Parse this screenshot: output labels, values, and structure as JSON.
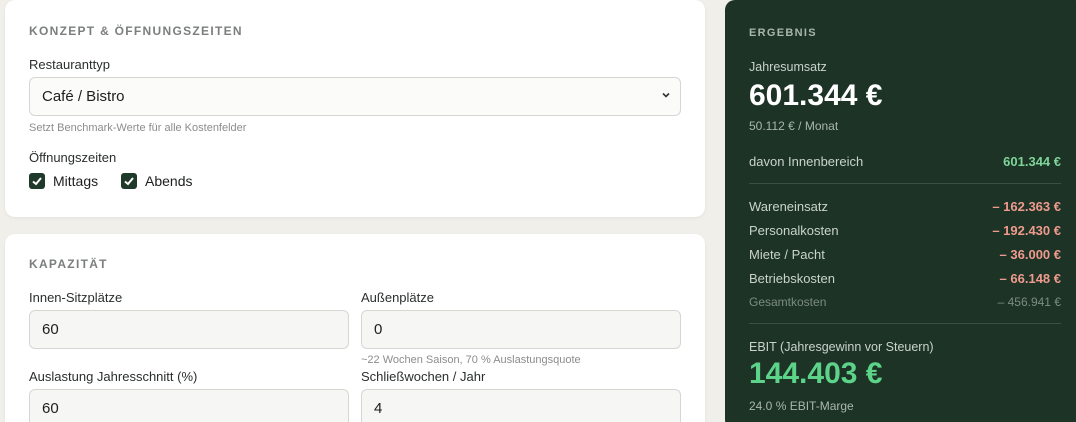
{
  "konzept": {
    "title": "KONZEPT & ÖFFNUNGSZEITEN",
    "restaurant_type_label": "Restauranttyp",
    "restaurant_type_value": "Café / Bistro",
    "restaurant_type_hint": "Setzt Benchmark-Werte für alle Kostenfelder",
    "opening_label": "Öffnungszeiten",
    "options": [
      {
        "label": "Mittags",
        "checked": true
      },
      {
        "label": "Abends",
        "checked": true
      }
    ]
  },
  "kapazitaet": {
    "title": "KAPAZITÄT",
    "indoor_label": "Innen-Sitzplätze",
    "indoor_value": "60",
    "outdoor_label": "Außenplätze",
    "outdoor_value": "0",
    "outdoor_hint": "~22 Wochen Saison, 70 % Auslastungsquote",
    "occupancy_label": "Auslastung Jahresschnitt (%)",
    "occupancy_value": "60",
    "closing_label": "Schließwochen / Jahr",
    "closing_value": "4"
  },
  "result": {
    "title": "ERGEBNIS",
    "revenue_label": "Jahresumsatz",
    "revenue_value": "601.344 €",
    "revenue_monthly": "50.112 € / Monat",
    "indoor_share_label": "davon Innenbereich",
    "indoor_share_value": "601.344 €",
    "costs": [
      {
        "label": "Wareneinsatz",
        "value": "– 162.363 €"
      },
      {
        "label": "Personalkosten",
        "value": "– 192.430 €"
      },
      {
        "label": "Miete / Pacht",
        "value": "– 36.000 €"
      },
      {
        "label": "Betriebskosten",
        "value": "– 66.148 €"
      }
    ],
    "total_label": "Gesamtkosten",
    "total_value": "– 456.941 €",
    "ebit_label": "EBIT (Jahresgewinn vor Steuern)",
    "ebit_value": "144.403 €",
    "ebit_margin": "24.0 % EBIT-Marge"
  },
  "colors": {
    "panel_bg": "#1c3325",
    "positive": "#5cd389",
    "negative": "#f09a8e",
    "checkbox": "#1f3a2a"
  }
}
